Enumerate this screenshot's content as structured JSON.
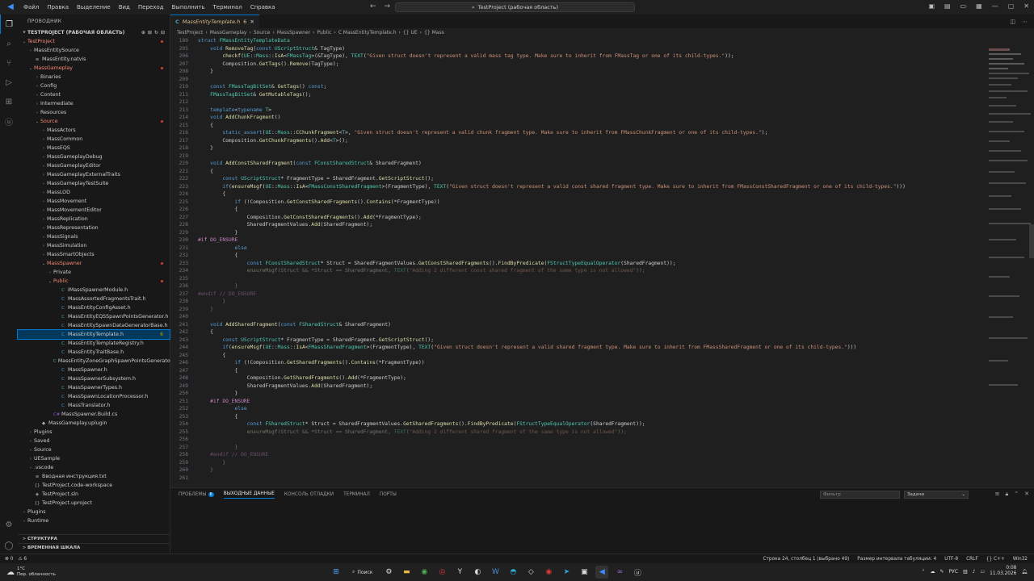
{
  "titlebar": {
    "menus": [
      "Файл",
      "Правка",
      "Выделение",
      "Вид",
      "Переход",
      "Выполнить",
      "Терминал",
      "Справка"
    ],
    "search": "TestProject (рабочая область)"
  },
  "sidebar": {
    "title": "ПРОВОДНИК",
    "workspace": "TESTPROJECT (РАБОЧАЯ ОБЛАСТЬ)",
    "tree": [
      {
        "label": "TestProject",
        "depth": 0,
        "tw": "v",
        "icon": "",
        "cls": "red",
        "dot": true
      },
      {
        "label": "MassEntitySource",
        "depth": 1,
        "tw": ">",
        "icon": ""
      },
      {
        "label": "MassEntity.natvis",
        "depth": 1,
        "tw": "",
        "icon": "≡"
      },
      {
        "label": "MassGameplay",
        "depth": 1,
        "tw": "v",
        "icon": "",
        "cls": "red",
        "dot": true
      },
      {
        "label": "Binaries",
        "depth": 2,
        "tw": ">",
        "icon": ""
      },
      {
        "label": "Config",
        "depth": 2,
        "tw": ">",
        "icon": ""
      },
      {
        "label": "Content",
        "depth": 2,
        "tw": ">",
        "icon": ""
      },
      {
        "label": "Intermediate",
        "depth": 2,
        "tw": ">",
        "icon": ""
      },
      {
        "label": "Resources",
        "depth": 2,
        "tw": ">",
        "icon": ""
      },
      {
        "label": "Source",
        "depth": 2,
        "tw": "v",
        "icon": "",
        "cls": "red",
        "dot": true
      },
      {
        "label": "MassActors",
        "depth": 3,
        "tw": ">",
        "icon": ""
      },
      {
        "label": "MassCommon",
        "depth": 3,
        "tw": ">",
        "icon": ""
      },
      {
        "label": "MassEQS",
        "depth": 3,
        "tw": ">",
        "icon": ""
      },
      {
        "label": "MassGameplayDebug",
        "depth": 3,
        "tw": ">",
        "icon": ""
      },
      {
        "label": "MassGameplayEditor",
        "depth": 3,
        "tw": ">",
        "icon": ""
      },
      {
        "label": "MassGameplayExternalTraits",
        "depth": 3,
        "tw": ">",
        "icon": ""
      },
      {
        "label": "MassGameplayTestSuite",
        "depth": 3,
        "tw": ">",
        "icon": ""
      },
      {
        "label": "MassLOD",
        "depth": 3,
        "tw": ">",
        "icon": ""
      },
      {
        "label": "MassMovement",
        "depth": 3,
        "tw": ">",
        "icon": ""
      },
      {
        "label": "MassMovementEditor",
        "depth": 3,
        "tw": ">",
        "icon": ""
      },
      {
        "label": "MassReplication",
        "depth": 3,
        "tw": ">",
        "icon": ""
      },
      {
        "label": "MassRepresentation",
        "depth": 3,
        "tw": ">",
        "icon": ""
      },
      {
        "label": "MassSignals",
        "depth": 3,
        "tw": ">",
        "icon": ""
      },
      {
        "label": "MassSimulation",
        "depth": 3,
        "tw": ">",
        "icon": ""
      },
      {
        "label": "MassSmartObjects",
        "depth": 3,
        "tw": ">",
        "icon": ""
      },
      {
        "label": "MassSpawner",
        "depth": 3,
        "tw": "v",
        "icon": "",
        "cls": "red",
        "dot": true
      },
      {
        "label": "Private",
        "depth": 4,
        "tw": ">",
        "icon": ""
      },
      {
        "label": "Public",
        "depth": 4,
        "tw": "v",
        "icon": "",
        "cls": "red",
        "dot": true
      },
      {
        "label": "IMassSpawnerModule.h",
        "depth": 5,
        "tw": "",
        "icon": "C"
      },
      {
        "label": "MassAssortedFragmentsTrait.h",
        "depth": 5,
        "tw": "",
        "icon": "C"
      },
      {
        "label": "MassEntityConfigAsset.h",
        "depth": 5,
        "tw": "",
        "icon": "C"
      },
      {
        "label": "MassEntityEQSSpawnPointsGenerator.h",
        "depth": 5,
        "tw": "",
        "icon": "C"
      },
      {
        "label": "MassEntitySpawnDataGeneratorBase.h",
        "depth": 5,
        "tw": "",
        "icon": "C"
      },
      {
        "label": "MassEntityTemplate.h",
        "depth": 5,
        "tw": "",
        "icon": "C",
        "sel": true,
        "badge": "6"
      },
      {
        "label": "MassEntityTemplateRegistry.h",
        "depth": 5,
        "tw": "",
        "icon": "C"
      },
      {
        "label": "MassEntityTraitBase.h",
        "depth": 5,
        "tw": "",
        "icon": "C"
      },
      {
        "label": "MassEntityZoneGraphSpawnPointsGenerator.h",
        "depth": 5,
        "tw": "",
        "icon": "C"
      },
      {
        "label": "MassSpawner.h",
        "depth": 5,
        "tw": "",
        "icon": "C"
      },
      {
        "label": "MassSpawnerSubsystem.h",
        "depth": 5,
        "tw": "",
        "icon": "C"
      },
      {
        "label": "MassSpawnerTypes.h",
        "depth": 5,
        "tw": "",
        "icon": "C"
      },
      {
        "label": "MassSpawnLocationProcessor.h",
        "depth": 5,
        "tw": "",
        "icon": "C"
      },
      {
        "label": "MassTranslator.h",
        "depth": 5,
        "tw": "",
        "icon": "C"
      },
      {
        "label": "MassSpawner.Build.cs",
        "depth": 4,
        "tw": "",
        "icon": "C#"
      },
      {
        "label": "MassGameplay.uplugin",
        "depth": 2,
        "tw": "",
        "icon": "◆"
      },
      {
        "label": "Plugins",
        "depth": 1,
        "tw": ">",
        "icon": ""
      },
      {
        "label": "Saved",
        "depth": 1,
        "tw": ">",
        "icon": ""
      },
      {
        "label": "Source",
        "depth": 1,
        "tw": ">",
        "icon": ""
      },
      {
        "label": "UESample",
        "depth": 1,
        "tw": ">",
        "icon": ""
      },
      {
        "label": ".vscode",
        "depth": 1,
        "tw": ">",
        "icon": ""
      },
      {
        "label": "Вводная инструкция.txt",
        "depth": 1,
        "tw": "",
        "icon": "≡"
      },
      {
        "label": "TestProject.code-workspace",
        "depth": 1,
        "tw": "",
        "icon": "{}"
      },
      {
        "label": "TestProject.sln",
        "depth": 1,
        "tw": "",
        "icon": "◈"
      },
      {
        "label": "TestProject.uproject",
        "depth": 1,
        "tw": "",
        "icon": "{}"
      },
      {
        "label": "Plugins",
        "depth": 0,
        "tw": ">",
        "icon": ""
      },
      {
        "label": "Runtime",
        "depth": 0,
        "tw": ">",
        "icon": ""
      }
    ],
    "outline": "СТРУКТУРА",
    "timeline": "ВРЕМЕННАЯ ШКАЛА"
  },
  "editor": {
    "tab": {
      "name": "MassEntityTemplate.h",
      "badge": "6"
    },
    "breadcrumbs": [
      "TestProject",
      "MassGameplay",
      "Source",
      "MassSpawner",
      "Public",
      "C MassEntityTemplate.h",
      "{} UE",
      "{} Mass"
    ],
    "lines": [
      {
        "n": "180",
        "t": "struct FMassEntityTemplateData"
      },
      {
        "n": "205",
        "t": "    void RemoveTag(const UScriptStruct& TagType)"
      },
      {
        "n": "206",
        "t": "        checkf(UE::Mass::IsA<FMassTag>(&TagType), TEXT(\"Given struct doesn't represent a valid mass tag type. Make sure to inherit from FMassTag or one of its child-types.\"));"
      },
      {
        "n": "207",
        "t": "        Composition.GetTags().Remove(TagType);"
      },
      {
        "n": "208",
        "t": "    }"
      },
      {
        "n": "209",
        "t": ""
      },
      {
        "n": "210",
        "t": "    const FMassTagBitSet& GetTags() const;"
      },
      {
        "n": "211",
        "t": "    FMassTagBitSet& GetMutableTags();"
      },
      {
        "n": "212",
        "t": ""
      },
      {
        "n": "213",
        "t": "    template<typename T>"
      },
      {
        "n": "214",
        "t": "    void AddChunkFragment()"
      },
      {
        "n": "215",
        "t": "    {"
      },
      {
        "n": "216",
        "t": "        static_assert(UE::Mass::CChunkFragment<T>, \"Given struct doesn't represent a valid chunk fragment type. Make sure to inherit from FMassChunkFragment or one of its child-types.\");"
      },
      {
        "n": "217",
        "t": "        Composition.GetChunkFragments().Add<T>();"
      },
      {
        "n": "218",
        "t": "    }"
      },
      {
        "n": "219",
        "t": ""
      },
      {
        "n": "220",
        "t": "    void AddConstSharedFragment(const FConstSharedStruct& SharedFragment)"
      },
      {
        "n": "221",
        "t": "    {"
      },
      {
        "n": "222",
        "t": "        const UScriptStruct* FragmentType = SharedFragment.GetScriptStruct();"
      },
      {
        "n": "223",
        "t": "        if(ensureMsgf(UE::Mass::IsA<FMassConstSharedFragment>(FragmentType), TEXT(\"Given struct doesn't represent a valid const shared fragment type. Make sure to inherit from FMassConstSharedFragment or one of its child-types.\")))"
      },
      {
        "n": "224",
        "t": "        {"
      },
      {
        "n": "225",
        "t": "            if (!Composition.GetConstSharedFragments().Contains(*FragmentType))"
      },
      {
        "n": "226",
        "t": "            {"
      },
      {
        "n": "227",
        "t": "                Composition.GetConstSharedFragments().Add(*FragmentType);"
      },
      {
        "n": "228",
        "t": "                SharedFragmentValues.Add(SharedFragment);"
      },
      {
        "n": "229",
        "t": "            }"
      },
      {
        "n": "230",
        "t": "#if DO_ENSURE"
      },
      {
        "n": "231",
        "t": "            else"
      },
      {
        "n": "232",
        "t": "            {"
      },
      {
        "n": "233",
        "t": "                const FConstSharedStruct* Struct = SharedFragmentValues.GetConstSharedFragments().FindByPredicate(FStructTypeEqualOperator(SharedFragment));"
      },
      {
        "n": "234",
        "t": "                ensureMsgf(Struct && *Struct == SharedFragment, TEXT(\"Adding 2 different const shared fragment of the same type is not allowed\"));"
      },
      {
        "n": "235",
        "t": ""
      },
      {
        "n": "236",
        "t": "            }"
      },
      {
        "n": "237",
        "t": "#endif // DO_ENSURE"
      },
      {
        "n": "238",
        "t": "        }"
      },
      {
        "n": "239",
        "t": "    }"
      },
      {
        "n": "240",
        "t": ""
      },
      {
        "n": "241",
        "t": "    void AddSharedFragment(const FSharedStruct& SharedFragment)"
      },
      {
        "n": "242",
        "t": "    {"
      },
      {
        "n": "243",
        "t": "        const UScriptStruct* FragmentType = SharedFragment.GetScriptStruct();"
      },
      {
        "n": "244",
        "t": "        if(ensureMsgf(UE::Mass::IsA<FMassSharedFragment>(FragmentType), TEXT(\"Given struct doesn't represent a valid shared fragment type. Make sure to inherit from FMassSharedFragment or one of its child-types.\")))"
      },
      {
        "n": "245",
        "t": "        {"
      },
      {
        "n": "246",
        "t": "            if (!Composition.GetSharedFragments().Contains(*FragmentType))"
      },
      {
        "n": "247",
        "t": "            {"
      },
      {
        "n": "248",
        "t": "                Composition.GetSharedFragments().Add(*FragmentType);"
      },
      {
        "n": "249",
        "t": "                SharedFragmentValues.Add(SharedFragment);"
      },
      {
        "n": "250",
        "t": "            }"
      },
      {
        "n": "251",
        "t": "    #if DO_ENSURE"
      },
      {
        "n": "252",
        "t": "            else"
      },
      {
        "n": "253",
        "t": "            {"
      },
      {
        "n": "254",
        "t": "                const FSharedStruct* Struct = SharedFragmentValues.GetSharedFragments().FindByPredicate(FStructTypeEqualOperator(SharedFragment));"
      },
      {
        "n": "255",
        "t": "                ensureMsgf(Struct && *Struct == SharedFragment, TEXT(\"Adding 2 different shared fragment of the same type is not allowed\"));"
      },
      {
        "n": "256",
        "t": ""
      },
      {
        "n": "257",
        "t": "            }"
      },
      {
        "n": "258",
        "t": "    #endif // DO_ENSURE"
      },
      {
        "n": "259",
        "t": "        }"
      },
      {
        "n": "260",
        "t": "    }"
      },
      {
        "n": "261",
        "t": ""
      }
    ]
  },
  "panel": {
    "tabs": [
      {
        "label": "ПРОБЛЕМЫ",
        "badge": "6"
      },
      {
        "label": "ВЫХОДНЫЕ ДАННЫЕ",
        "active": true
      },
      {
        "label": "КОНСОЛЬ ОТЛАДКИ"
      },
      {
        "label": "ТЕРМИНАЛ"
      },
      {
        "label": "ПОРТЫ"
      }
    ],
    "filter_placeholder": "Фильтр",
    "task_select": "Задачи"
  },
  "status": {
    "left": [
      "⊗ 0",
      "⚠ 6"
    ],
    "right": [
      "Строка 24, столбец 1 (выбрано 49)",
      "Размер интервала табуляции: 4",
      "UTF-8",
      "CRLF",
      "{} C++",
      "Win32"
    ]
  },
  "taskbar": {
    "weather_temp": "1°C",
    "weather_desc": "Пер. облачность",
    "search": "Поиск",
    "lang": "РУС",
    "time": "0:08",
    "date": "11.03.2026"
  }
}
